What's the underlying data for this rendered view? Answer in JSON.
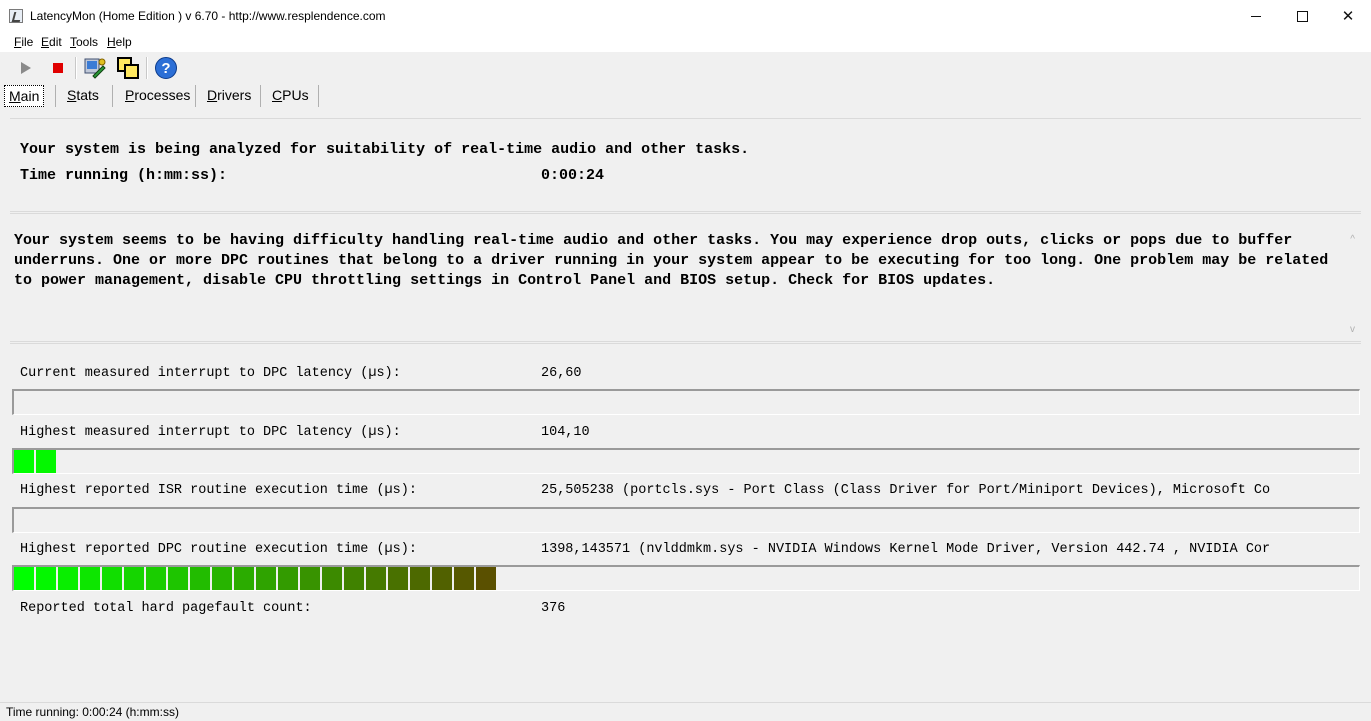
{
  "window": {
    "title": "LatencyMon  (Home Edition )  v 6.70 - http://www.resplendence.com",
    "minimize_label": "–",
    "close_label": "✕"
  },
  "menu": [
    "File",
    "Edit",
    "Tools",
    "Help"
  ],
  "toolbar_icons": [
    "play-icon",
    "stop-icon",
    "driver-tool-icon",
    "copy-windows-icon",
    "help-icon"
  ],
  "toolbar": {
    "help_glyph": "?"
  },
  "tabs": [
    "Main",
    "Stats",
    "Processes",
    "Drivers",
    "CPUs"
  ],
  "analysis": {
    "message": "Your system is being analyzed for suitability of real-time audio and other tasks.",
    "time_label": "Time running (h:mm:ss):",
    "time_value": "0:00:24"
  },
  "verdict": "Your system seems to be having difficulty handling real-time audio and other tasks. You may experience drop outs, clicks or pops due to buffer underruns. One or more DPC routines that belong to a driver running in your system appear to be executing for too long. One problem may be related to power management, disable CPU throttling settings in Control Panel and BIOS setup. Check for BIOS updates.",
  "scroll": {
    "up": "^",
    "down": "v"
  },
  "stats": [
    {
      "label": "Current measured interrupt to DPC latency (µs):",
      "value": "26,60",
      "fill_segments": 0
    },
    {
      "label": "Highest measured interrupt to DPC latency (µs):",
      "value": "104,10",
      "fill_segments": 2
    },
    {
      "label": "Highest reported ISR routine execution time (µs):",
      "value": "25,505238   (portcls.sys - Port Class (Class Driver for Port/Miniport Devices), Microsoft Co",
      "fill_segments": 0
    },
    {
      "label": "Highest reported DPC routine execution time (µs):",
      "value": "1398,143571   (nvlddmkm.sys - NVIDIA Windows Kernel Mode Driver, Version 442.74 , NVIDIA Cor",
      "fill_segments": 22
    },
    {
      "label": "Reported total hard pagefault count:",
      "value": "376"
    }
  ],
  "colors": {
    "bar_start": "#00ff00",
    "bar_end": "#5a5000"
  },
  "status": "Time running: 0:00:24  (h:mm:ss)"
}
